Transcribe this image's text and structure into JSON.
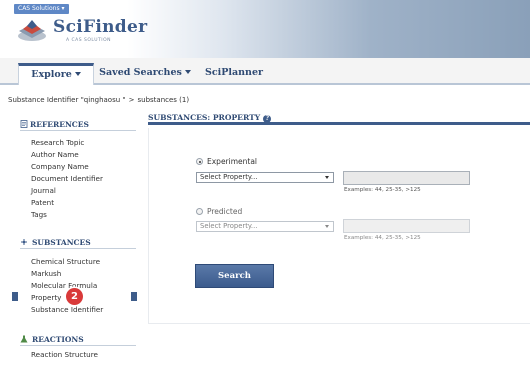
{
  "header": {
    "cas_tag": "CAS Solutions ▾",
    "logo_text": "SciFinder",
    "logo_subtitle": "A CAS SOLUTION"
  },
  "nav": {
    "tabs": [
      {
        "label": "Explore",
        "active": true,
        "has_dropdown": true
      },
      {
        "label": "Saved Searches",
        "active": false,
        "has_dropdown": true
      },
      {
        "label": "SciPlanner",
        "active": false,
        "has_dropdown": false
      }
    ]
  },
  "breadcrumb": {
    "first": "Substance Identifier \"qinghaosu \"",
    "separator": ">",
    "second": "substances (1)"
  },
  "sidebar": {
    "sections": [
      {
        "title": "REFERENCES",
        "icon": "document-icon",
        "items": [
          "Research Topic",
          "Author Name",
          "Company Name",
          "Document Identifier",
          "Journal",
          "Patent",
          "Tags"
        ]
      },
      {
        "title": "SUBSTANCES",
        "icon": "molecule-icon",
        "items": [
          "Chemical Structure",
          "Markush",
          "Molecular Formula",
          "Property",
          "Substance Identifier"
        ]
      },
      {
        "title": "REACTIONS",
        "icon": "flask-icon",
        "items": [
          "Reaction Structure"
        ]
      }
    ],
    "selected_item": "Property",
    "badge_number": "2"
  },
  "main": {
    "title": "SUBSTANCES: PROPERTY",
    "help_icon": "?",
    "experimental": {
      "label": "Experimental",
      "checked": true,
      "select_value": "Select Property...",
      "value": "",
      "examples": "Examples: 44, 25-35, >125"
    },
    "predicted": {
      "label": "Predicted",
      "checked": false,
      "select_value": "Select Property...",
      "value": "",
      "examples": "Examples: 44, 25-35, >125"
    },
    "search_button": "Search"
  },
  "colors": {
    "brand_blue": "#3e5c8a",
    "badge_red": "#d93a3a",
    "header_gradient_end": "#8aa0b9"
  }
}
